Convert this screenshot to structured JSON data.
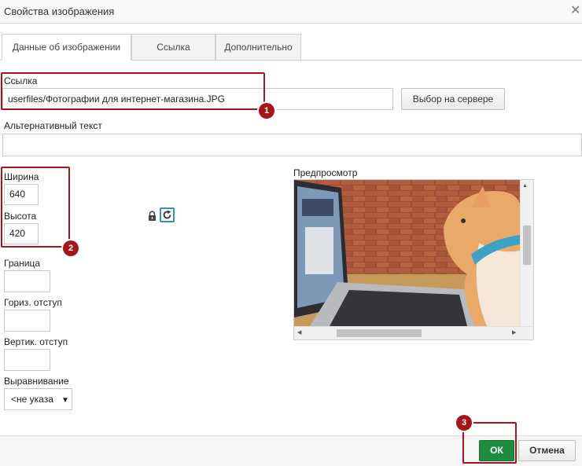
{
  "dialog": {
    "title": "Свойства изображения"
  },
  "tabs": [
    {
      "label": "Данные об изображении",
      "active": true
    },
    {
      "label": "Ссылка",
      "active": false
    },
    {
      "label": "Дополнительно",
      "active": false
    }
  ],
  "url": {
    "label": "Ссылка",
    "value": "userfiles/Фотографии для интернет-магазина.JPG",
    "browse_button": "Выбор на сервере"
  },
  "alt": {
    "label": "Альтернативный текст",
    "value": ""
  },
  "dimensions": {
    "width_label": "Ширина",
    "width_value": "640",
    "height_label": "Высота",
    "height_value": "420"
  },
  "border": {
    "label": "Граница",
    "value": ""
  },
  "hspace": {
    "label": "Гориз. отступ",
    "value": ""
  },
  "vspace": {
    "label": "Вертик. отступ",
    "value": ""
  },
  "align": {
    "label": "Выравнивание",
    "value": "<не указа"
  },
  "preview": {
    "label": "Предпросмотр"
  },
  "annotations": [
    "1",
    "2",
    "3"
  ],
  "footer": {
    "ok": "ОК",
    "cancel": "Отмена"
  },
  "colors": {
    "accent_green": "#1e8d3f",
    "annotation_red": "#a4161a"
  },
  "icons": [
    "close-icon",
    "lock-icon",
    "reset-size-icon",
    "dropdown-arrow-icon"
  ]
}
